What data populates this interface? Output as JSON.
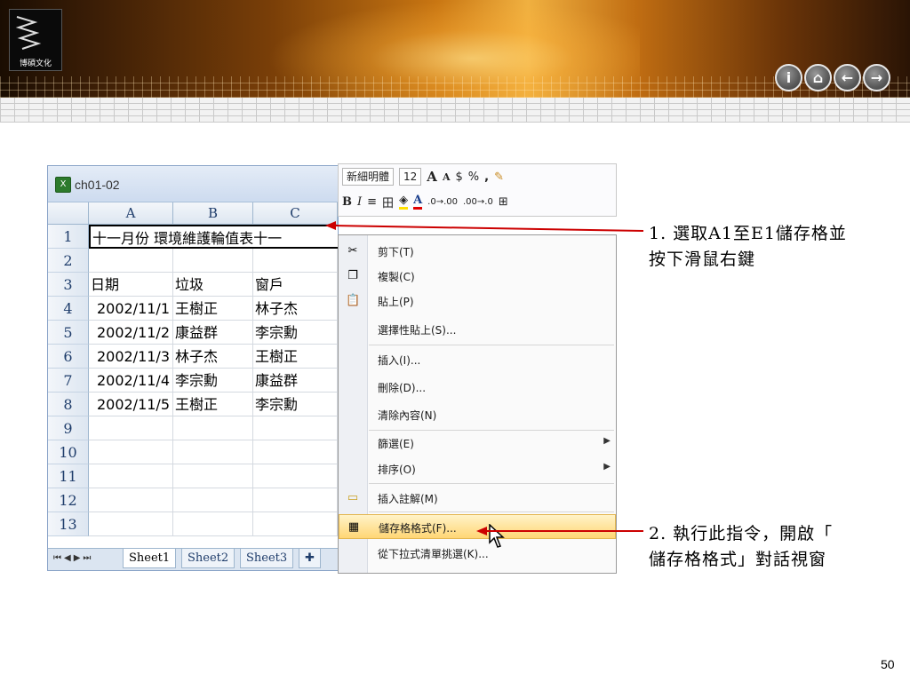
{
  "header": {
    "logo_text": "博碩文化",
    "nav_buttons": [
      {
        "icon": "info-icon",
        "glyph": "i"
      },
      {
        "icon": "home-icon",
        "glyph": "⌂"
      },
      {
        "icon": "back-icon",
        "glyph": "←"
      },
      {
        "icon": "forward-icon",
        "glyph": "→"
      }
    ]
  },
  "excel": {
    "title": "ch01-02",
    "columns": [
      "A",
      "B",
      "C"
    ],
    "rows": [
      "1",
      "2",
      "3",
      "4",
      "5",
      "6",
      "7",
      "8",
      "9",
      "10",
      "11",
      "12",
      "13"
    ],
    "title_cell": "十一月份 環境維護輪值表十一",
    "cells": [
      [
        "",
        "",
        ""
      ],
      [
        "日期",
        "垃圾",
        "窗戶"
      ],
      [
        "2002/11/1",
        "王樹正",
        "林子杰"
      ],
      [
        "2002/11/2",
        "康益群",
        "李宗勳"
      ],
      [
        "2002/11/3",
        "林子杰",
        "王樹正"
      ],
      [
        "2002/11/4",
        "李宗勳",
        "康益群"
      ],
      [
        "2002/11/5",
        "王樹正",
        "李宗勳"
      ]
    ],
    "sheet_tabs": [
      "Sheet1",
      "Sheet2",
      "Sheet3"
    ]
  },
  "mini_toolbar": {
    "font_name": "新細明體",
    "font_size": "12",
    "row1_symbols": [
      "A",
      "A",
      "$",
      "%",
      ","
    ],
    "row2_symbols": [
      "B",
      "I",
      "≡",
      "田",
      "A"
    ]
  },
  "context_menu": {
    "items": [
      {
        "label": "剪下(T)",
        "icon": "scissors-icon",
        "glyph": "✂",
        "submenu": false
      },
      {
        "label": "複製(C)",
        "icon": "copy-icon",
        "glyph": "❐",
        "submenu": false
      },
      {
        "label": "貼上(P)",
        "icon": "paste-icon",
        "glyph": "📋",
        "submenu": false
      },
      {
        "label": "選擇性貼上(S)...",
        "icon": "",
        "glyph": "",
        "submenu": false
      },
      {
        "label": "插入(I)...",
        "icon": "",
        "glyph": "",
        "submenu": false
      },
      {
        "label": "刪除(D)...",
        "icon": "",
        "glyph": "",
        "submenu": false
      },
      {
        "label": "清除內容(N)",
        "icon": "",
        "glyph": "",
        "submenu": false
      },
      {
        "label": "篩選(E)",
        "icon": "",
        "glyph": "",
        "submenu": true
      },
      {
        "label": "排序(O)",
        "icon": "",
        "glyph": "",
        "submenu": true
      },
      {
        "label": "插入註解(M)",
        "icon": "comment-icon",
        "glyph": "▭",
        "submenu": false
      },
      {
        "label": "儲存格格式(F)...",
        "icon": "format-cells-icon",
        "glyph": "▦",
        "submenu": false
      },
      {
        "label": "從下拉式清單挑選(K)...",
        "icon": "",
        "glyph": "",
        "submenu": false
      }
    ],
    "highlighted_index": 10
  },
  "annotations": {
    "step1_line1": "1. 選取A1至E1儲存格並",
    "step1_line2": "按下滑鼠右鍵",
    "step2_line1": "2. 執行此指令，開啟「",
    "step2_line2": "儲存格格式」對話視窗"
  },
  "page_number": "50",
  "colors": {
    "arrow": "#cc0000",
    "highlight": "#ffd675"
  }
}
